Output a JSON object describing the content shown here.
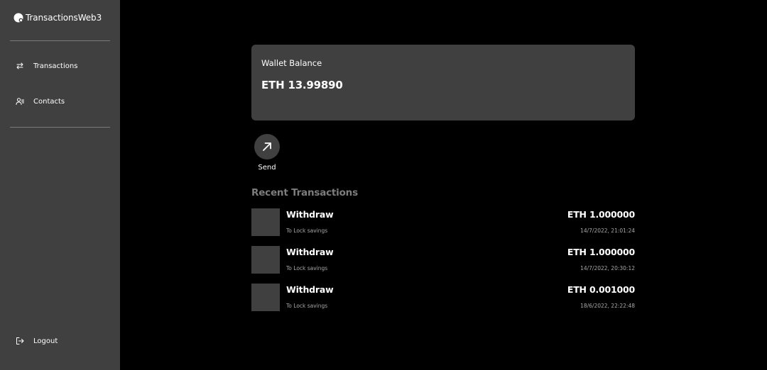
{
  "sidebar": {
    "brand": {
      "name": "TransactionsWeb3",
      "icon": "logo-icon"
    },
    "nav": [
      {
        "label": "Transactions",
        "icon": "arrows-swap-icon"
      },
      {
        "label": "Contacts",
        "icon": "contacts-icon"
      }
    ],
    "logout": {
      "label": "Logout",
      "icon": "logout-icon"
    }
  },
  "wallet": {
    "title": "Wallet Balance",
    "balance": "ETH 13.99890"
  },
  "actions": {
    "send": {
      "label": "Send",
      "icon": "arrow-up-right-icon"
    }
  },
  "recent": {
    "title": "Recent Transactions",
    "items": [
      {
        "type": "Withdraw",
        "description": "To Lock savings",
        "amount": "ETH 1.000000",
        "date": "14/7/2022, 21:01:24"
      },
      {
        "type": "Withdraw",
        "description": "To Lock savings",
        "amount": "ETH 1.000000",
        "date": "14/7/2022, 20:30:12"
      },
      {
        "type": "Withdraw",
        "description": "To Lock savings",
        "amount": "ETH 0.001000",
        "date": "18/6/2022, 22:22:48"
      }
    ]
  },
  "colors": {
    "background": "#000000",
    "panel": "#404040",
    "muted_text": "#a8a8a8",
    "section_title": "#7d7d7d"
  }
}
